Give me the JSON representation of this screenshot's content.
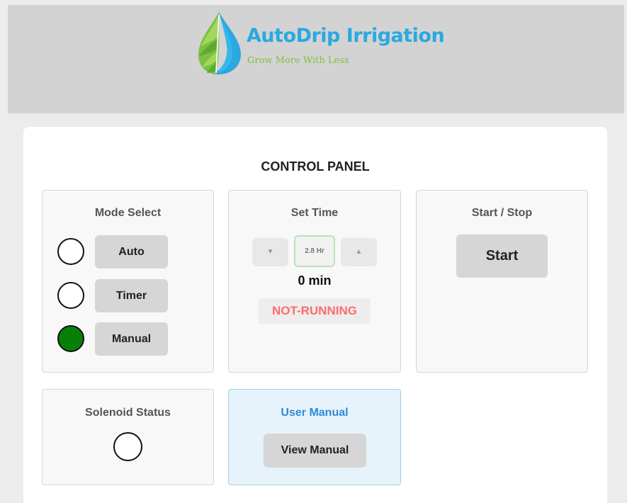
{
  "header": {
    "brand_name": "AutoDrip Irrigation",
    "tagline": "Grow More With Less",
    "logo_icon": "water-drop-leaf-icon",
    "background": "#d3d3d3",
    "brand_color": "#29a9e1",
    "tagline_color": "#7cc142"
  },
  "panel": {
    "title": "CONTROL PANEL"
  },
  "mode_select": {
    "title": "Mode Select",
    "options": [
      {
        "label": "Auto",
        "selected": false
      },
      {
        "label": "Timer",
        "selected": false
      },
      {
        "label": "Manual",
        "selected": true
      }
    ],
    "selected_color": "#078007"
  },
  "set_time": {
    "title": "Set Time",
    "decrement_icon": "triangle-down-icon",
    "increment_icon": "triangle-up-icon",
    "decrement_glyph": "▼",
    "increment_glyph": "▲",
    "input_value": "2.8 Hr",
    "remaining": "0 min",
    "status": "NOT-RUNNING",
    "status_color": "#ff6b6b"
  },
  "start_stop": {
    "title": "Start / Stop",
    "button_label": "Start"
  },
  "solenoid": {
    "title": "Solenoid Status",
    "active": false
  },
  "user_manual": {
    "title": "User Manual",
    "button_label": "View Manual",
    "accent": "#2f8bd8"
  }
}
